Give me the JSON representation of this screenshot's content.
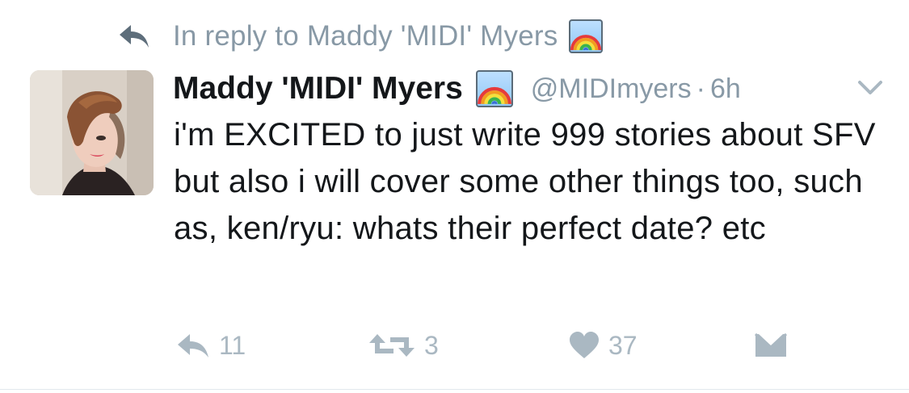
{
  "reply_context": {
    "text": "In reply to Maddy 'MIDI' Myers",
    "emoji": "rainbow-emoji"
  },
  "tweet": {
    "display_name": "Maddy 'MIDI' Myers",
    "name_emoji": "rainbow-emoji",
    "handle": "@MIDImyers",
    "separator": "·",
    "time": "6h",
    "text": "i'm EXCITED to just write 999 stories about SFV but also i will cover some other things too, such as, ken/ryu: whats their perfect date? etc"
  },
  "actions": {
    "reply_count": "11",
    "retweet_count": "3",
    "like_count": "37"
  },
  "colors": {
    "text_primary": "#14171a",
    "text_secondary": "#8899a6",
    "icon_muted": "#aab8c2",
    "divider": "#e1e8ed"
  },
  "icons": [
    "reply-icon",
    "rainbow-emoji",
    "chevron-down-icon",
    "retweet-icon",
    "heart-icon",
    "envelope-icon"
  ]
}
